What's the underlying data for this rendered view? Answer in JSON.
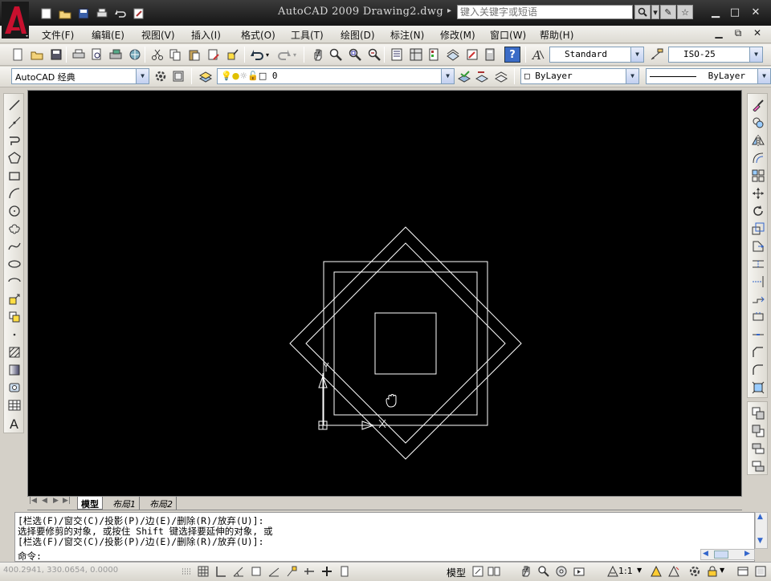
{
  "window": {
    "title": "AutoCAD 2009 Drawing2.dwg",
    "search_placeholder": "键入关键字或短语",
    "minimize": "▁",
    "maximize": "□",
    "close": "✕",
    "doc_minimize": "▁",
    "doc_restore": "⧉",
    "doc_close": "✕"
  },
  "menu": {
    "items": [
      "文件(F)",
      "编辑(E)",
      "视图(V)",
      "插入(I)",
      "格式(O)",
      "工具(T)",
      "绘图(D)",
      "标注(N)",
      "修改(M)",
      "窗口(W)",
      "帮助(H)"
    ]
  },
  "styles_toolbar": {
    "text_style": "Standard",
    "dim_style": "ISO-25"
  },
  "workspace_toolbar": {
    "workspace": "AutoCAD 经典",
    "layer_name": "0",
    "color": "ByLayer",
    "linetype": "ByLayer"
  },
  "layout_tabs": [
    "模型",
    "布局1",
    "布局2"
  ],
  "command_line": {
    "lines": [
      "[栏选(F)/窗交(C)/投影(P)/边(E)/删除(R)/放弃(U)]:",
      "选择要修剪的对象, 或按住 Shift 键选择要延伸的对象, 或",
      "[栏选(F)/窗交(C)/投影(P)/边(E)/删除(R)/放弃(U)]:"
    ],
    "prompt": "命令:"
  },
  "status": {
    "coordinates": "400.2941, 330.0654, 0.0000",
    "model_label": "模型",
    "scale": "1:1"
  },
  "colors": {
    "canvas_bg": "#000000",
    "geometry": "#ffffff",
    "logo_red": "#c8102e"
  },
  "icons": {
    "logo": "autocad-a-logo",
    "cursor": "pan-hand-icon"
  }
}
